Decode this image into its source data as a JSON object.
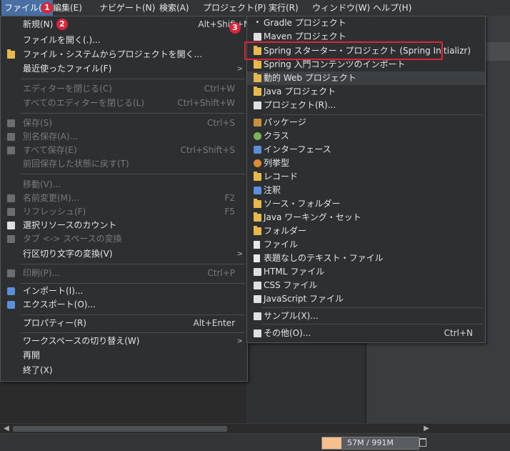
{
  "menubar": {
    "items": [
      "ファイル(F)",
      "編集(E)",
      "ナビゲート(N)",
      "検索(A)",
      "プロジェクト(P)",
      "実行(R)",
      "ウィンドウ(W)",
      "ヘルプ(H)"
    ]
  },
  "file_menu": {
    "items": [
      {
        "label": "新規(N)",
        "accel": "Alt+Shift+N",
        "submenu": true
      },
      {
        "label": "ファイルを開く(.)..."
      },
      {
        "label": "ファイル・システムからプロジェクトを開く..."
      },
      {
        "label": "最近使ったファイル(F)",
        "submenu": true
      },
      {
        "label": "エディターを閉じる(C)",
        "accel": "Ctrl+W",
        "disabled": true
      },
      {
        "label": "すべてのエディターを閉じる(L)",
        "accel": "Ctrl+Shift+W",
        "disabled": true
      },
      {
        "label": "保存(S)",
        "accel": "Ctrl+S",
        "disabled": true
      },
      {
        "label": "別名保存(A)...",
        "disabled": true
      },
      {
        "label": "すべて保存(E)",
        "accel": "Ctrl+Shift+S",
        "disabled": true
      },
      {
        "label": "前回保存した状態に戻す(T)",
        "disabled": true
      },
      {
        "label": "移動(V)...",
        "disabled": true
      },
      {
        "label": "名前変更(M)...",
        "accel": "F2",
        "disabled": true
      },
      {
        "label": "リフレッシュ(F)",
        "accel": "F5",
        "disabled": true
      },
      {
        "label": "選択リソースのカウント"
      },
      {
        "label": "タブ <-> スペースの変換",
        "disabled": true
      },
      {
        "label": "行区切り文字の変換(V)",
        "submenu": true
      },
      {
        "label": "印刷(P)...",
        "accel": "Ctrl+P",
        "disabled": true
      },
      {
        "label": "インポート(I)..."
      },
      {
        "label": "エクスポート(O)..."
      },
      {
        "label": "プロパティー(R)",
        "accel": "Alt+Enter"
      },
      {
        "label": "ワークスペースの切り替え(W)",
        "submenu": true
      },
      {
        "label": "再開"
      },
      {
        "label": "終了(X)"
      }
    ]
  },
  "new_menu": {
    "items": [
      {
        "label": "Gradle プロジェクト"
      },
      {
        "label": "Maven プロジェクト"
      },
      {
        "label": "Spring スターター・プロジェクト (Spring Initializr)"
      },
      {
        "label": "Spring 入門コンテンツのインポート"
      },
      {
        "label": "動的 Web プロジェクト"
      },
      {
        "label": "Java プロジェクト"
      },
      {
        "label": "プロジェクト(R)..."
      },
      {
        "label": "パッケージ"
      },
      {
        "label": "クラス"
      },
      {
        "label": "インターフェース"
      },
      {
        "label": "列挙型"
      },
      {
        "label": "レコード"
      },
      {
        "label": "注釈"
      },
      {
        "label": "ソース・フォルダー"
      },
      {
        "label": "Java ワーキング・セット"
      },
      {
        "label": "フォルダー"
      },
      {
        "label": "ファイル"
      },
      {
        "label": "表題なしのテキスト・ファイル"
      },
      {
        "label": "HTML ファイル"
      },
      {
        "label": "CSS ファイル"
      },
      {
        "label": "JavaScript ファイル"
      },
      {
        "label": "サンプル(X)..."
      },
      {
        "label": "その他(O)...",
        "accel": "Ctrl+N"
      }
    ]
  },
  "badges": [
    "1",
    "2",
    "3"
  ],
  "status": {
    "heap": "57M / 991M",
    "heap_used_fraction": 0.2
  }
}
